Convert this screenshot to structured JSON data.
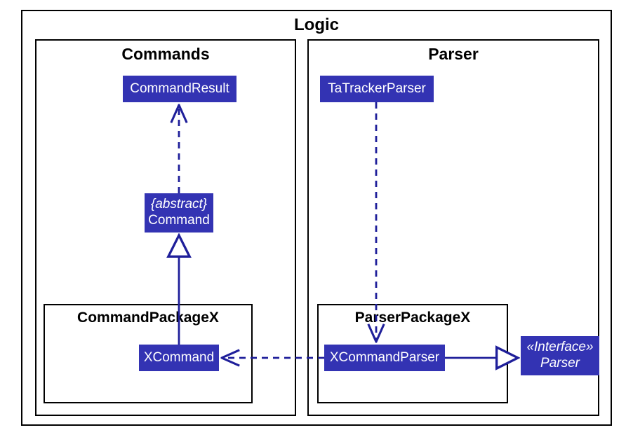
{
  "diagram": {
    "title": "Logic",
    "packages": {
      "commands": {
        "title": "Commands",
        "sub": {
          "title": "CommandPackageX"
        }
      },
      "parser": {
        "title": "Parser",
        "sub": {
          "title": "ParserPackageX"
        }
      }
    },
    "classes": {
      "commandResult": "CommandResult",
      "command": {
        "stereo": "{abstract}",
        "name": "Command"
      },
      "xCommand": "XCommand",
      "taTrackerParser": "TaTrackerParser",
      "xCommandParser": "XCommandParser",
      "parserInterface": {
        "stereo": "«Interface»",
        "name": "Parser"
      }
    }
  },
  "colors": {
    "box": "#3333b3",
    "boxText": "#ffffff",
    "arrow": "#1f1f9a"
  }
}
